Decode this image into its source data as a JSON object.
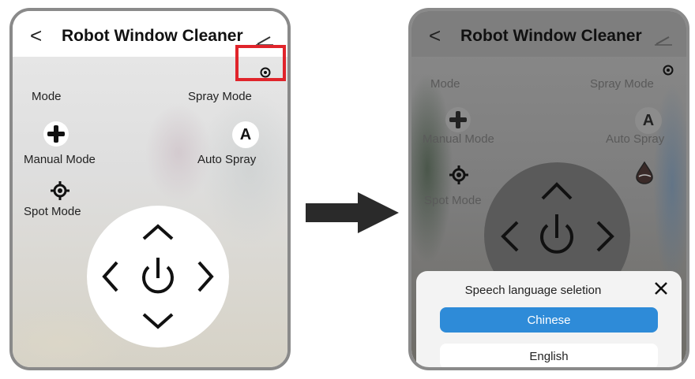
{
  "left_screen": {
    "header": {
      "back": "<",
      "title": "Robot Window Cleaner"
    },
    "mode_label": "Mode",
    "spray_mode_label": "Spray Mode",
    "manual_mode_label": "Manual Mode",
    "auto_spray_icon_text": "A",
    "auto_spray_label": "Auto Spray",
    "spot_mode_label": "Spot Mode"
  },
  "right_screen": {
    "header": {
      "back": "<",
      "title": "Robot Window Cleaner"
    },
    "mode_label": "Mode",
    "spray_mode_label": "Spray Mode",
    "manual_mode_label": "Manual Mode",
    "auto_spray_icon_text": "A",
    "auto_spray_label": "Auto Spray",
    "spot_mode_label": "Spot Mode",
    "sheet": {
      "title": "Speech language seletion",
      "options": [
        "Chinese",
        "English"
      ],
      "selected": "Chinese"
    }
  },
  "icons": {
    "back": "chevron-left-icon",
    "edit": "edit-icon",
    "settings": "settings-dot-icon",
    "manual": "plus-icon",
    "spot": "target-icon",
    "drop": "drop-icon",
    "power": "power-icon",
    "close": "close-icon"
  },
  "colors": {
    "highlight": "#e0242b",
    "selected_option": "#2e8bd8"
  }
}
